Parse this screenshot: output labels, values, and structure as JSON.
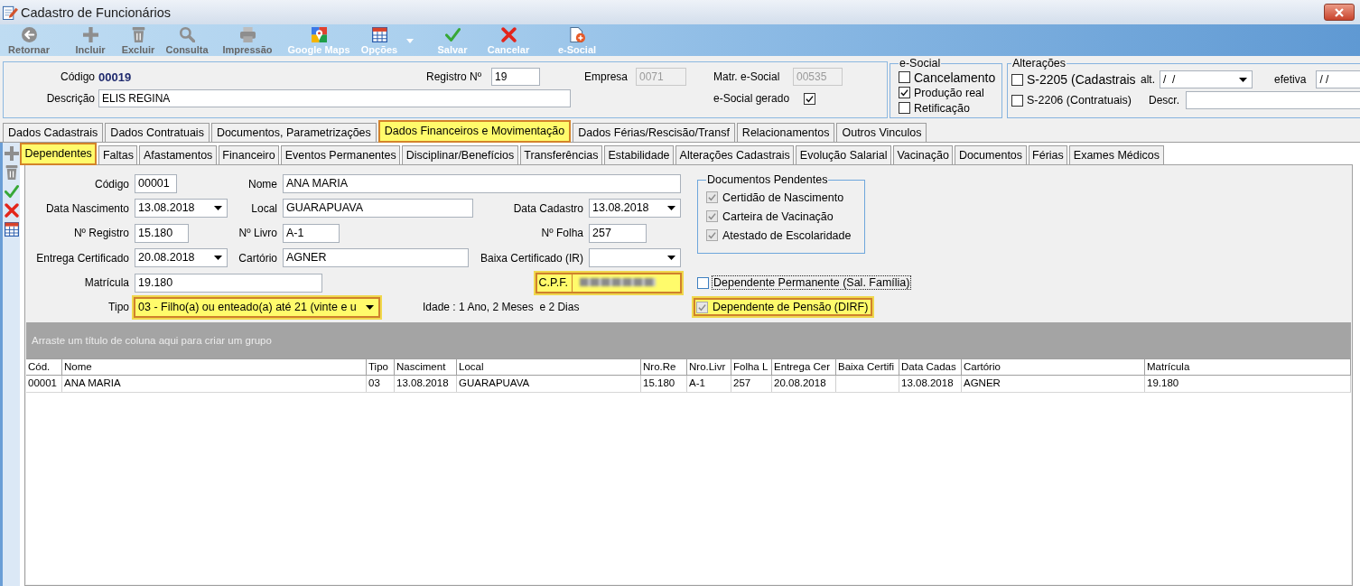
{
  "window": {
    "title": "Cadastro de Funcionários"
  },
  "toolbar": [
    {
      "label": "Retornar",
      "kind": "back",
      "disabled": true,
      "menu": false
    },
    {
      "label": "Incluir",
      "kind": "add",
      "disabled": true,
      "menu": false
    },
    {
      "label": "Excluir",
      "kind": "delete",
      "disabled": true,
      "menu": false
    },
    {
      "label": "Consulta",
      "kind": "search",
      "disabled": true,
      "menu": false
    },
    {
      "label": "Impressão",
      "kind": "print",
      "disabled": true,
      "menu": false
    },
    {
      "label": "Google Maps",
      "kind": "map",
      "disabled": false,
      "menu": false
    },
    {
      "label": "Opções",
      "kind": "options",
      "disabled": false,
      "menu": true
    },
    {
      "label": "Salvar",
      "kind": "save",
      "disabled": false,
      "menu": false
    },
    {
      "label": "Cancelar",
      "kind": "cancel",
      "disabled": false,
      "menu": false
    },
    {
      "label": "e-Social",
      "kind": "esocial",
      "disabled": false,
      "menu": false
    }
  ],
  "header": {
    "codigo": {
      "label": "Código",
      "value": "00019"
    },
    "registro": {
      "label": "Registro Nº",
      "value": "19"
    },
    "empresa": {
      "label": "Empresa",
      "value": "0071",
      "disabled": true
    },
    "matricula_esocial": {
      "label": "Matr. e-Social",
      "value": "00535",
      "disabled": true
    },
    "esocial_gerado": {
      "label": "e-Social gerado",
      "checked": true
    },
    "descricao": {
      "label": "Descrição",
      "value": "ELIS REGINA"
    }
  },
  "esocial": {
    "title": "e-Social",
    "options": [
      {
        "label": "Cancelamento",
        "checked": false
      },
      {
        "label": "Produção real",
        "checked": true
      },
      {
        "label": "Retificação",
        "checked": false
      }
    ]
  },
  "alteracoes": {
    "title": "Alterações",
    "options": [
      {
        "label": "S-2205 (Cadastrais",
        "checked": false
      },
      {
        "label": "S-2206 (Contratuais)",
        "checked": false
      }
    ],
    "alt": {
      "label": "alt.",
      "value": "/  /"
    },
    "efetiva": {
      "label": "efetiva",
      "value": "/  /"
    },
    "descr": {
      "label": "Descr."
    }
  },
  "main_tabs": [
    {
      "label": "Dados Cadastrais",
      "selected": false,
      "highlighted": false
    },
    {
      "label": "Dados Contratuais",
      "selected": false,
      "highlighted": false
    },
    {
      "label": "Documentos, Parametrizações",
      "selected": false,
      "highlighted": false
    },
    {
      "label": "Dados Financeiros e Movimentação",
      "selected": true,
      "highlighted": true
    },
    {
      "label": "Dados Férias/Rescisão/Transf",
      "selected": false,
      "highlighted": false
    },
    {
      "label": "Relacionamentos",
      "selected": false,
      "highlighted": false
    },
    {
      "label": "Outros Vinculos",
      "selected": false,
      "highlighted": false
    }
  ],
  "side_toolbar": [
    {
      "kind": "add",
      "disabled": true
    },
    {
      "kind": "delete",
      "disabled": true
    },
    {
      "kind": "confirm",
      "disabled": false
    },
    {
      "kind": "cancel",
      "disabled": false
    },
    {
      "kind": "grid",
      "disabled": false
    }
  ],
  "sub_tabs": [
    {
      "label": "Dependentes",
      "selected": true,
      "highlighted": true
    },
    {
      "label": "Faltas",
      "selected": false,
      "highlighted": false
    },
    {
      "label": "Afastamentos",
      "selected": false,
      "highlighted": false
    },
    {
      "label": "Financeiro",
      "selected": false,
      "highlighted": false
    },
    {
      "label": "Eventos Permanentes",
      "selected": false,
      "highlighted": false
    },
    {
      "label": "Disciplinar/Benefícios",
      "selected": false,
      "highlighted": false
    },
    {
      "label": "Transferências",
      "selected": false,
      "highlighted": false
    },
    {
      "label": "Estabilidade",
      "selected": false,
      "highlighted": false
    },
    {
      "label": "Alterações Cadastrais",
      "selected": false,
      "highlighted": false
    },
    {
      "label": "Evolução Salarial",
      "selected": false,
      "highlighted": false
    },
    {
      "label": "Vacinação",
      "selected": false,
      "highlighted": false
    },
    {
      "label": "Documentos",
      "selected": false,
      "highlighted": false
    },
    {
      "label": "Férias",
      "selected": false,
      "highlighted": false
    },
    {
      "label": "Exames Médicos",
      "selected": false,
      "highlighted": false
    }
  ],
  "form": {
    "codigo": {
      "label": "Código",
      "value": "00001"
    },
    "nome": {
      "label": "Nome",
      "value": "ANA MARIA"
    },
    "data_nascimento": {
      "label": "Data Nascimento",
      "value": "13.08.2018"
    },
    "local": {
      "label": "Local",
      "value": "GUARAPUAVA"
    },
    "data_cadastro": {
      "label": "Data Cadastro",
      "value": "13.08.2018"
    },
    "registro": {
      "label": "Nº Registro",
      "value": "15.180"
    },
    "livro": {
      "label": "Nº Livro",
      "value": "A-1"
    },
    "folha": {
      "label": "Nº Folha",
      "value": "257"
    },
    "entrega_certificado": {
      "label": "Entrega Certificado",
      "value": "20.08.2018"
    },
    "cartorio": {
      "label": "Cartório",
      "value": "AGNER"
    },
    "baixa_certificado": {
      "label": "Baixa Certificado (IR)"
    },
    "matricula": {
      "label": "Matrícula",
      "value": "19.180"
    },
    "cpf": {
      "label": "C.P.F.",
      "redacted": true,
      "highlighted": true
    },
    "tipo": {
      "label": "Tipo",
      "value": "03 - Filho(a) ou enteado(a) até 21 (vinte e u",
      "highlighted": true
    },
    "idade": "Idade : 1 Ano, 2 Meses  e 2 Dias",
    "documentos_pendentes": {
      "title": "Documentos Pendentes",
      "items": [
        {
          "label": "Certidão de Nascimento",
          "checked": true,
          "disabled": true
        },
        {
          "label": "Carteira de Vacinação",
          "checked": true,
          "disabled": true
        },
        {
          "label": "Atestado de Escolaridade",
          "checked": true,
          "disabled": true
        }
      ]
    },
    "flags": [
      {
        "label": "Dependente Permanente (Sal. Família)",
        "checked": false,
        "disabled": false,
        "focused": true,
        "highlighted": false
      },
      {
        "label": "Dependente de Pensão (DIRF)",
        "checked": true,
        "disabled": true,
        "focused": false,
        "highlighted": true
      }
    ]
  },
  "grid": {
    "group_hint": "Arraste um título de coluna aqui para criar um grupo",
    "columns": [
      "Cód.",
      "Nome",
      "Tipo",
      "Nasciment",
      "Local",
      "Nro.Re",
      "Nro.Livr",
      "Folha L",
      "Entrega Cer",
      "Baixa Certifi",
      "Data Cadas",
      "Cartório",
      "Matrícula"
    ],
    "rows": [
      [
        "00001",
        "ANA MARIA",
        "03",
        "13.08.2018",
        "GUARAPUAVA",
        "15.180",
        "A-1",
        "257",
        "20.08.2018",
        null,
        "13.08.2018",
        "AGNER",
        "19.180"
      ]
    ]
  }
}
